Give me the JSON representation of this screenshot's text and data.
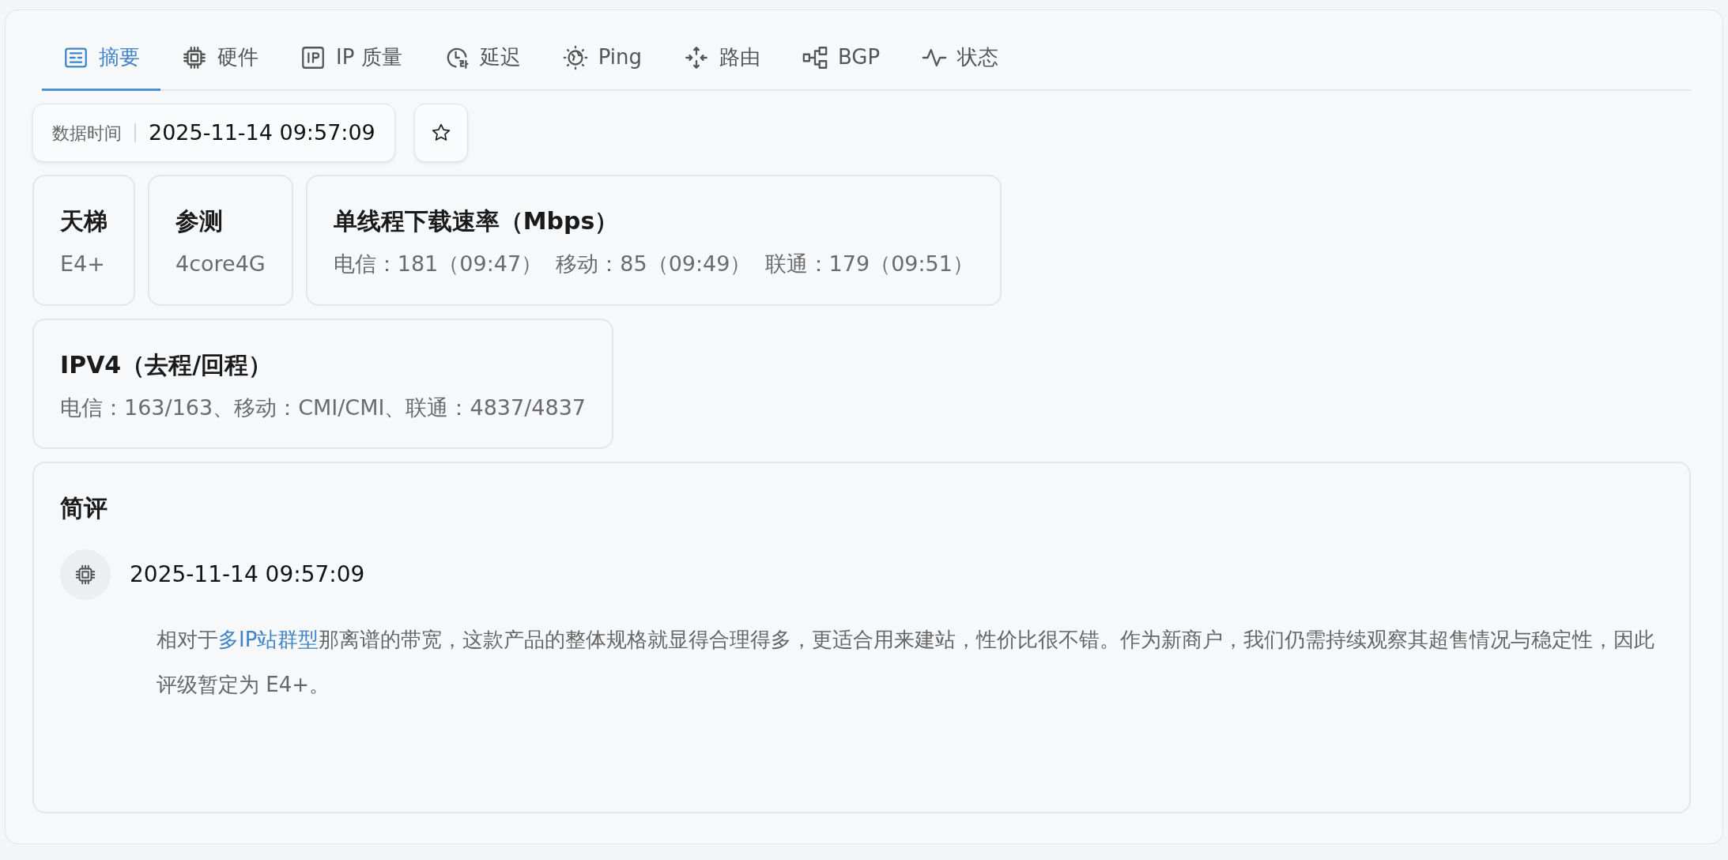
{
  "tabs": [
    {
      "label": "摘要",
      "selected": true
    },
    {
      "label": "硬件",
      "selected": false
    },
    {
      "label": "IP 质量",
      "selected": false
    },
    {
      "label": "延迟",
      "selected": false
    },
    {
      "label": "Ping",
      "selected": false
    },
    {
      "label": "路由",
      "selected": false
    },
    {
      "label": "BGP",
      "selected": false
    },
    {
      "label": "状态",
      "selected": false
    }
  ],
  "data_time": {
    "label": "数据时间",
    "value": "2025-11-14 09:57:09"
  },
  "stats": [
    {
      "title": "天梯",
      "value": "E4+"
    },
    {
      "title": "参测",
      "value": "4core4G"
    },
    {
      "title": "单线程下载速率（Mbps）",
      "value": "电信：181（09:47）  移动：85（09:49）  联通：179（09:51）"
    }
  ],
  "ipv4": {
    "title": "IPV4（去程/回程）",
    "value": "电信：163/163、移动：CMI/CMI、联通：4837/4837"
  },
  "review": {
    "title": "简评",
    "time": "2025-11-14 09:57:09",
    "text_before": "相对于",
    "link": "多IP站群型",
    "text_after": "那离谱的带宽，这款产品的整体规格就显得合理得多，更适合用来建站，性价比很不错。作为新商户，我们仍需持续观察其超售情况与稳定性，因此评级暂定为 E4+。"
  }
}
